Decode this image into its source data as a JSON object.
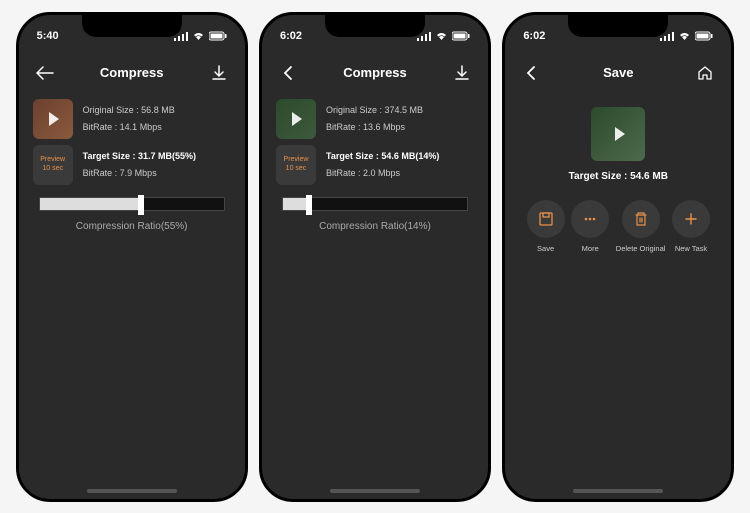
{
  "screens": [
    {
      "time": "5:40",
      "title": "Compress",
      "original_size": "Original Size : 56.8 MB",
      "original_bitrate": "BitRate : 14.1 Mbps",
      "preview_label": "Preview",
      "preview_time": "10 sec",
      "target_size": "Target Size : 31.7 MB(55%)",
      "target_bitrate": "BitRate : 7.9 Mbps",
      "compression_label": "Compression Ratio(55%)",
      "slider_pct": 55
    },
    {
      "time": "6:02",
      "title": "Compress",
      "original_size": "Original Size : 374.5 MB",
      "original_bitrate": "BitRate : 13.6 Mbps",
      "preview_label": "Preview",
      "preview_time": "10 sec",
      "target_size": "Target Size : 54.6 MB(14%)",
      "target_bitrate": "BitRate : 2.0 Mbps",
      "compression_label": "Compression Ratio(14%)",
      "slider_pct": 14
    },
    {
      "time": "6:02",
      "title": "Save",
      "target_size": "Target Size : 54.6 MB",
      "actions": [
        {
          "label": "Save"
        },
        {
          "label": "More"
        },
        {
          "label": "Delete Original"
        },
        {
          "label": "New Task"
        }
      ]
    }
  ]
}
